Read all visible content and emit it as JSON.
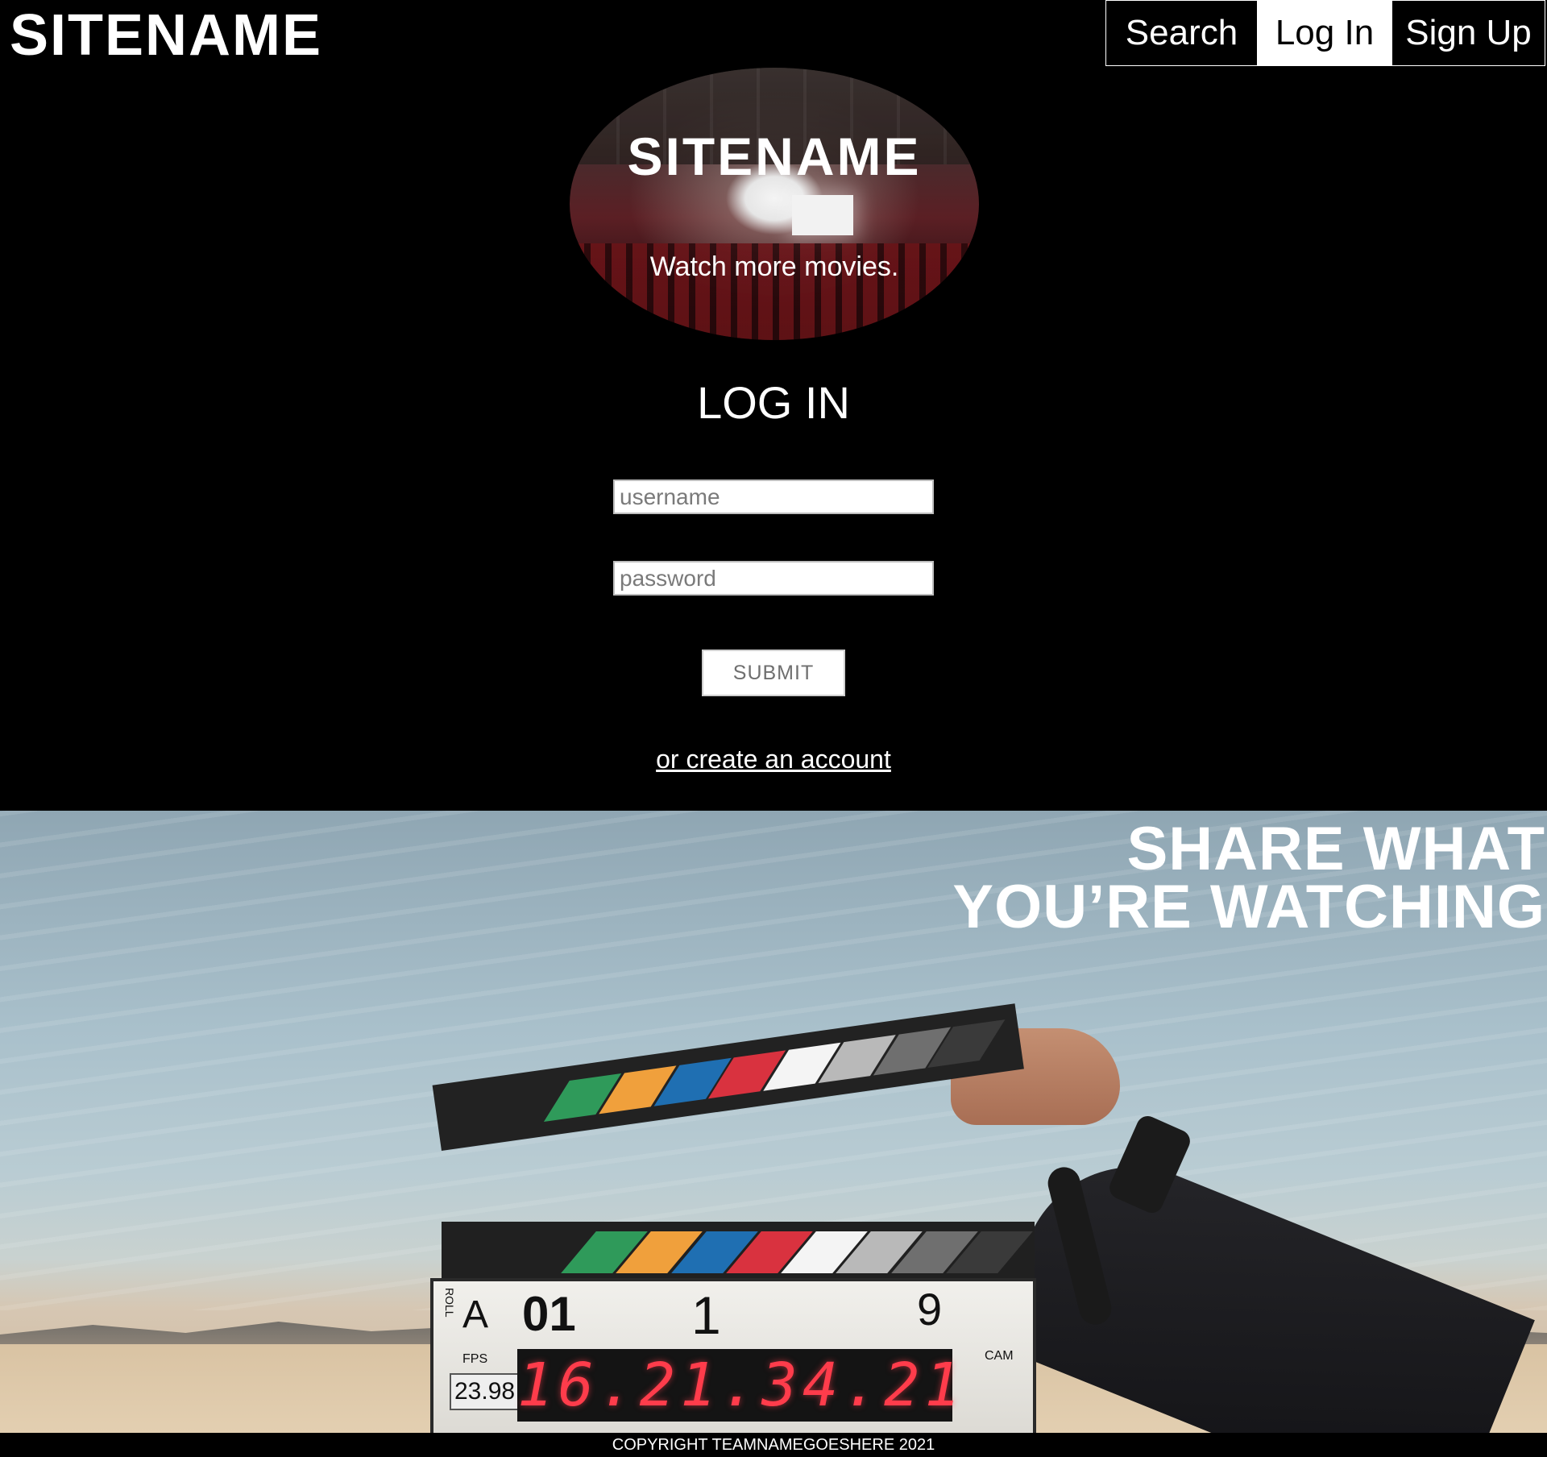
{
  "header": {
    "logo": "SITENAME",
    "nav": [
      {
        "label": "Search",
        "active": false
      },
      {
        "label": "Log In",
        "active": true
      },
      {
        "label": "Sign Up",
        "active": false
      }
    ]
  },
  "hero": {
    "title": "SITENAME",
    "tagline": "Watch more movies."
  },
  "login": {
    "heading": "LOG IN",
    "username_placeholder": "username",
    "password_placeholder": "password",
    "submit_label": "SUBMIT",
    "create_account_link": "or create an account"
  },
  "share": {
    "heading_line1": "SHARE WHAT",
    "heading_line2": "YOU’RE WATCHING",
    "clapperboard": {
      "roll_label": "ROLL",
      "roll": "A",
      "scene": "01",
      "shot": "1",
      "take": "9",
      "fps_label": "FPS",
      "fps": "23.98",
      "cam_label": "CAM",
      "timecode": "16.21.34.21",
      "stripe_colors": [
        "#2f9a5a",
        "#f0a03c",
        "#1f6fb2",
        "#d9323f",
        "#f4f4f4",
        "#b9b9b9",
        "#6f6f6f",
        "#3a3a3a"
      ]
    }
  },
  "footer": {
    "copyright": "COPYRIGHT TEAMNAMEGOESHERE 2021"
  },
  "colors": {
    "background": "#000000",
    "text": "#ffffff",
    "timecode": "#ff3c4b"
  }
}
